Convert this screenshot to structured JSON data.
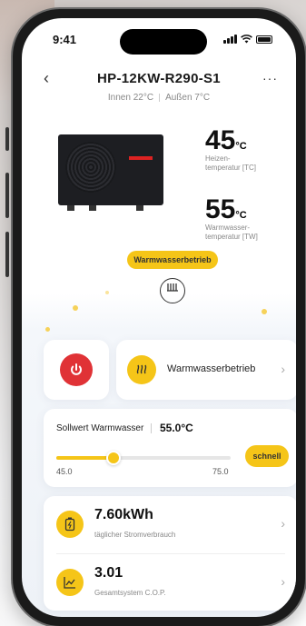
{
  "status_bar": {
    "time": "9:41"
  },
  "header": {
    "back_icon": "‹",
    "title": "HP-12KW-R290-S1",
    "more_icon": "···",
    "indoor": "Innen 22°C",
    "outdoor": "Außen 7°C"
  },
  "heating_temp": {
    "value": "45",
    "unit": "°C",
    "label_line1": "Heizen-",
    "label_line2": "temperatur [TC]"
  },
  "water_temp": {
    "value": "55",
    "unit": "°C",
    "label_line1": "Warmwasser-",
    "label_line2": "temperatur [TW]"
  },
  "mode_badge": "Warmwasserbetrieb",
  "mode_icon": "heating-coil-icon",
  "controls": {
    "power_icon": "power-icon",
    "mode_label": "Warmwasserbetrieb",
    "mode_icon": "hot-water-icon"
  },
  "setpoint": {
    "label": "Sollwert Warmwasser",
    "value": "55.0°C",
    "min": "45.0",
    "max": "75.0",
    "level_fraction": 0.33,
    "fast_label": "schnell"
  },
  "stats": [
    {
      "icon": "battery-icon",
      "value": "7.60kWh",
      "caption": "täglicher Stromverbrauch"
    },
    {
      "icon": "chart-icon",
      "value": "3.01",
      "caption": "Gesamtsystem C.O.P."
    }
  ],
  "colors": {
    "accent": "#f5c518",
    "power": "#e03236"
  }
}
